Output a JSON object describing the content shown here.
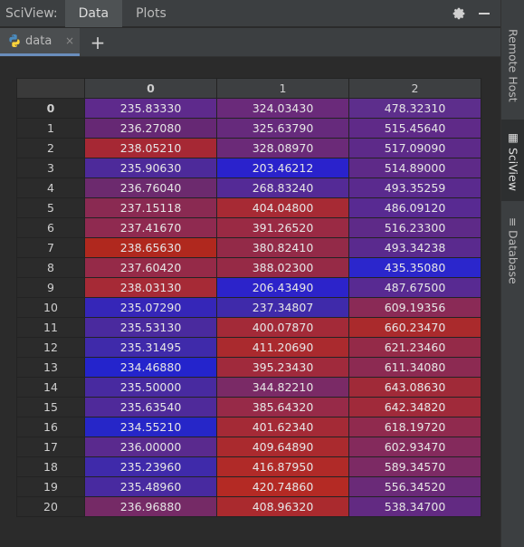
{
  "app": {
    "title": "SciView:"
  },
  "view_tabs": [
    {
      "label": "Data",
      "active": true
    },
    {
      "label": "Plots",
      "active": false
    }
  ],
  "toolbar_icons": [
    "gear-icon",
    "minimize-icon"
  ],
  "file_tab": {
    "label": "data",
    "close": "×",
    "icon": "python-icon"
  },
  "add_tab": {
    "label": "+"
  },
  "side_tabs": [
    {
      "label": "Remote Host",
      "icon": "",
      "active": false
    },
    {
      "label": "SciView",
      "icon": "▦",
      "active": true
    },
    {
      "label": "Database",
      "icon": "≡",
      "active": false
    }
  ],
  "table": {
    "columns": [
      "0",
      "1",
      "2"
    ],
    "rows": [
      {
        "index": "0",
        "values": [
          "235.83330",
          "324.03430",
          "478.32310"
        ],
        "colors": [
          "#5e2a8c",
          "#6a2a7a",
          "#5d2e8c"
        ]
      },
      {
        "index": "1",
        "values": [
          "236.27080",
          "325.63790",
          "515.45640"
        ],
        "colors": [
          "#662874",
          "#662a7c",
          "#5f2a88"
        ]
      },
      {
        "index": "2",
        "values": [
          "238.05210",
          "328.08970",
          "517.09090"
        ],
        "colors": [
          "#a62834",
          "#6b2a78",
          "#5d2a89"
        ]
      },
      {
        "index": "3",
        "values": [
          "235.90630",
          "203.46212",
          "514.89000"
        ],
        "colors": [
          "#4d2a9a",
          "#2a22cc",
          "#5e2a88"
        ]
      },
      {
        "index": "4",
        "values": [
          "236.76040",
          "268.83240",
          "493.35259"
        ],
        "colors": [
          "#6c2a6e",
          "#542a96",
          "#5a2a8e"
        ]
      },
      {
        "index": "5",
        "values": [
          "237.15118",
          "404.04800",
          "486.09120"
        ],
        "colors": [
          "#8a2a52",
          "#a72a34",
          "#582a92"
        ]
      },
      {
        "index": "6",
        "values": [
          "237.41670",
          "391.26520",
          "516.23300"
        ],
        "colors": [
          "#8f2a50",
          "#9a2a44",
          "#5e2a88"
        ]
      },
      {
        "index": "7",
        "values": [
          "238.65630",
          "380.82410",
          "493.34238"
        ],
        "colors": [
          "#b0281e",
          "#932a48",
          "#5a2a8e"
        ]
      },
      {
        "index": "8",
        "values": [
          "237.60420",
          "388.02300",
          "435.35080"
        ],
        "colors": [
          "#952a48",
          "#962a46",
          "#2b26cc"
        ]
      },
      {
        "index": "9",
        "values": [
          "238.03130",
          "206.43490",
          "487.67500"
        ],
        "colors": [
          "#a62a36",
          "#2c23ca",
          "#582a92"
        ]
      },
      {
        "index": "10",
        "values": [
          "235.07290",
          "237.34807",
          "609.19356"
        ],
        "colors": [
          "#3526b8",
          "#3f2aaa",
          "#8a2a56"
        ]
      },
      {
        "index": "11",
        "values": [
          "235.53130",
          "400.07870",
          "660.23470"
        ],
        "colors": [
          "#4a2a9e",
          "#a32a38",
          "#aa2a2c"
        ]
      },
      {
        "index": "12",
        "values": [
          "235.31495",
          "411.20690",
          "621.23460"
        ],
        "colors": [
          "#3f2aaa",
          "#aa2a2e",
          "#942a48"
        ]
      },
      {
        "index": "13",
        "values": [
          "234.46880",
          "395.23430",
          "611.34080"
        ],
        "colors": [
          "#2424cc",
          "#a02a3c",
          "#8c2a52"
        ]
      },
      {
        "index": "14",
        "values": [
          "235.50000",
          "344.82210",
          "643.08630"
        ],
        "colors": [
          "#482aa0",
          "#7a2a66",
          "#a02a38"
        ]
      },
      {
        "index": "15",
        "values": [
          "235.63540",
          "385.64320",
          "642.34820"
        ],
        "colors": [
          "#4f2a9a",
          "#972a48",
          "#a02a3a"
        ]
      },
      {
        "index": "16",
        "values": [
          "234.55210",
          "401.62340",
          "618.19720"
        ],
        "colors": [
          "#2626c8",
          "#a42a36",
          "#902a4e"
        ]
      },
      {
        "index": "17",
        "values": [
          "236.00000",
          "409.64890",
          "602.93470"
        ],
        "colors": [
          "#5a2a8e",
          "#aa2a2e",
          "#842a5c"
        ]
      },
      {
        "index": "18",
        "values": [
          "235.23960",
          "416.87950",
          "589.34570"
        ],
        "colors": [
          "#3f2aaa",
          "#b02a28",
          "#7c2a64"
        ]
      },
      {
        "index": "19",
        "values": [
          "235.48960",
          "420.74860",
          "556.34520"
        ],
        "colors": [
          "#482aa0",
          "#b42a24",
          "#6a2a78"
        ]
      },
      {
        "index": "20",
        "values": [
          "236.96880",
          "408.96320",
          "538.34700"
        ],
        "colors": [
          "#752a66",
          "#aa2a2e",
          "#622a82"
        ]
      }
    ]
  }
}
